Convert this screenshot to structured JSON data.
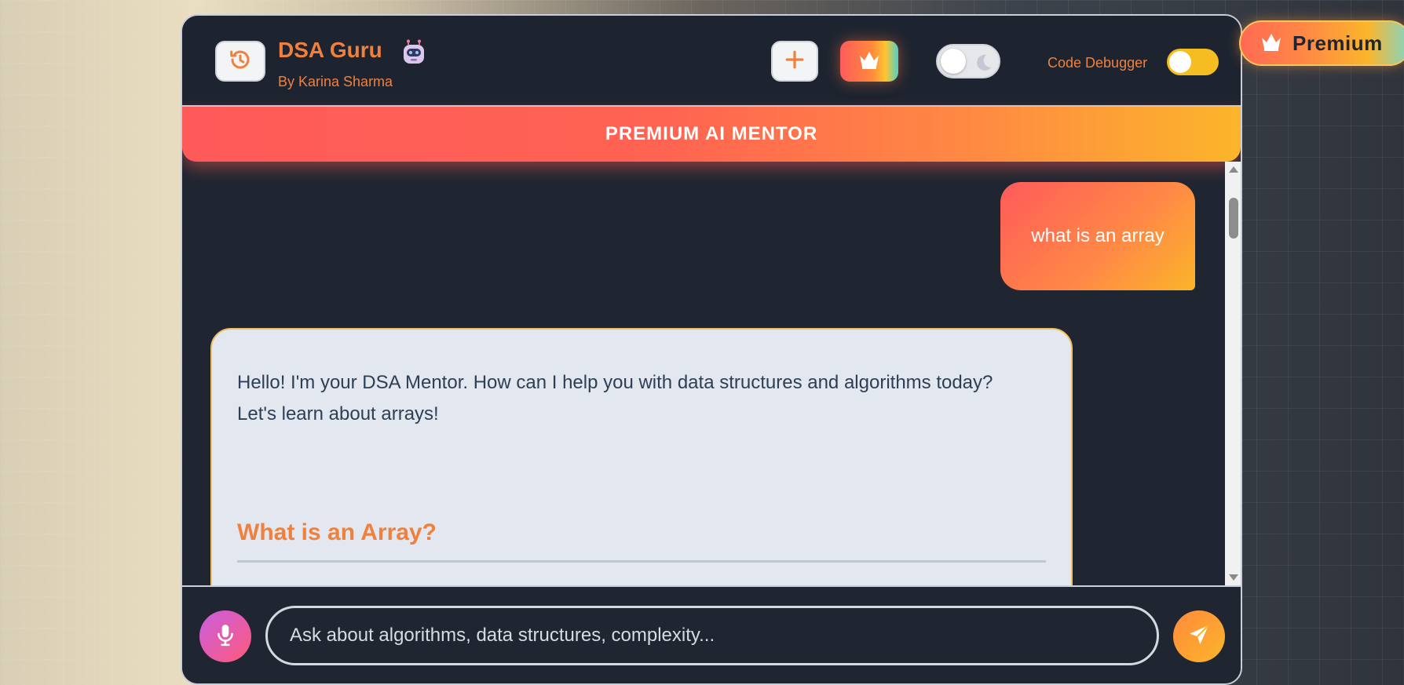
{
  "app": {
    "title": "DSA Guru",
    "subtitle": "By Karina Sharma",
    "banner": "PREMIUM AI MENTOR",
    "debugger_label": "Code Debugger"
  },
  "header": {
    "history_icon": "history-icon",
    "new_chat_icon": "plus-icon",
    "premium_icon": "crown-icon",
    "theme_toggle_state": "light",
    "debugger_enabled": true
  },
  "messages": {
    "user_message": "what is an array",
    "bot_line1": "Hello! I'm your DSA Mentor. How can I help you with data structures and algorithms today?",
    "bot_line2": "Let's learn about arrays!",
    "bot_heading": "What is an Array?"
  },
  "input": {
    "placeholder": "Ask about algorithms, data structures, complexity..."
  },
  "premium_badge": {
    "label": "Premium"
  },
  "colors": {
    "accent": "#f0803d",
    "bg_dark": "#1f2632",
    "bubble_bg": "#e3e7ef",
    "bot_text": "#2d3f55",
    "toggle_on": "#f5bd1f"
  }
}
